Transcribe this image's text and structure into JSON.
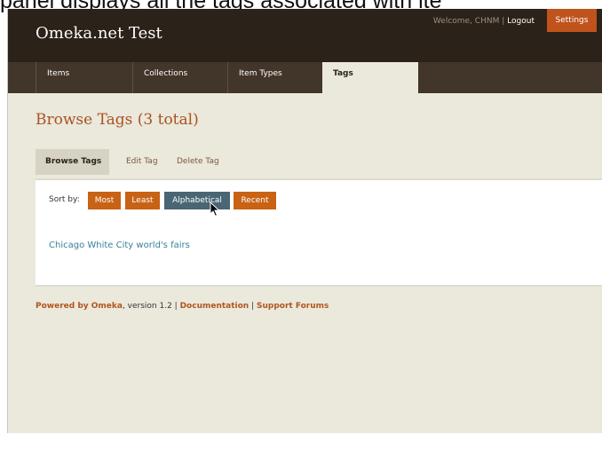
{
  "caption": "panel displays all the tags associated with ite",
  "header": {
    "site_title": "Omeka.net Test",
    "welcome_text": "Welcome, CHNM",
    "separator": "|",
    "logout_label": "Logout",
    "settings_label": "Settings"
  },
  "nav": {
    "tabs": [
      {
        "label": "Items"
      },
      {
        "label": "Collections"
      },
      {
        "label": "Item Types"
      },
      {
        "label": "Tags",
        "active": true
      }
    ]
  },
  "page": {
    "title": "Browse Tags (3 total)",
    "subnav": [
      {
        "label": "Browse Tags",
        "active": true
      },
      {
        "label": "Edit Tag"
      },
      {
        "label": "Delete Tag"
      }
    ]
  },
  "sort": {
    "label": "Sort by:",
    "options": [
      {
        "label": "Most"
      },
      {
        "label": "Least"
      },
      {
        "label": "Alphabetical",
        "active": true
      },
      {
        "label": "Recent"
      }
    ]
  },
  "tags": {
    "cloud_text": "Chicago White City world's fairs"
  },
  "footer": {
    "powered_label": "Powered by Omeka",
    "version_text": ", version 1.2 | ",
    "documentation_label": "Documentation",
    "sep": " | ",
    "support_label": "Support Forums"
  },
  "colors": {
    "header_bg": "#2b2219",
    "nav_bg": "#42352a",
    "accent_orange": "#c86214",
    "active_sort": "#4a6674",
    "title_color": "#a85322",
    "link_color": "#36819a"
  }
}
